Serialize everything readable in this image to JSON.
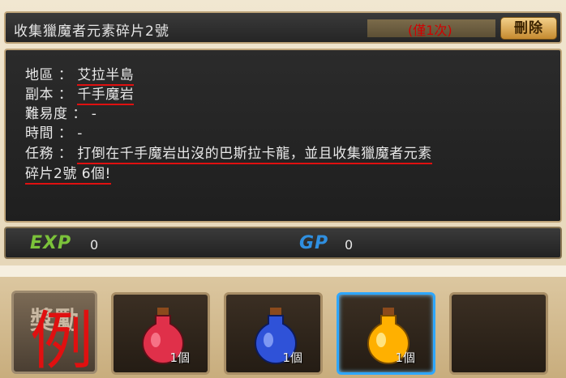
{
  "quest": {
    "title": "收集獵魔者元素碎片2號",
    "repeat": "(僅1次)",
    "delete_label": "刪除"
  },
  "info": {
    "region_label": "地區 ： ",
    "region_value": "艾拉半島",
    "dungeon_label": "副本 ： ",
    "dungeon_value": "千手魔岩",
    "difficulty": "難易度 ： -",
    "time": "時間 ： -",
    "mission_label": "任務 ： ",
    "mission_line1": "打倒在千手魔岩出沒的巴斯拉卡龍，並且收集獵魔者元素",
    "mission_line2": "碎片2號 6個!"
  },
  "rewards_summary": {
    "exp_label": "EXP",
    "exp_value": "0",
    "gp_label": "GP",
    "gp_value": "0"
  },
  "reward_badge": {
    "text": "獎勵",
    "example": "例"
  },
  "rewards": [
    {
      "icon": "red-potion-icon",
      "color": "#e0304a",
      "count": "1個"
    },
    {
      "icon": "blue-potion-icon",
      "color": "#2f52d8",
      "count": "1個"
    },
    {
      "icon": "orange-potion-icon",
      "color": "#ffb000",
      "count": "1個"
    }
  ]
}
